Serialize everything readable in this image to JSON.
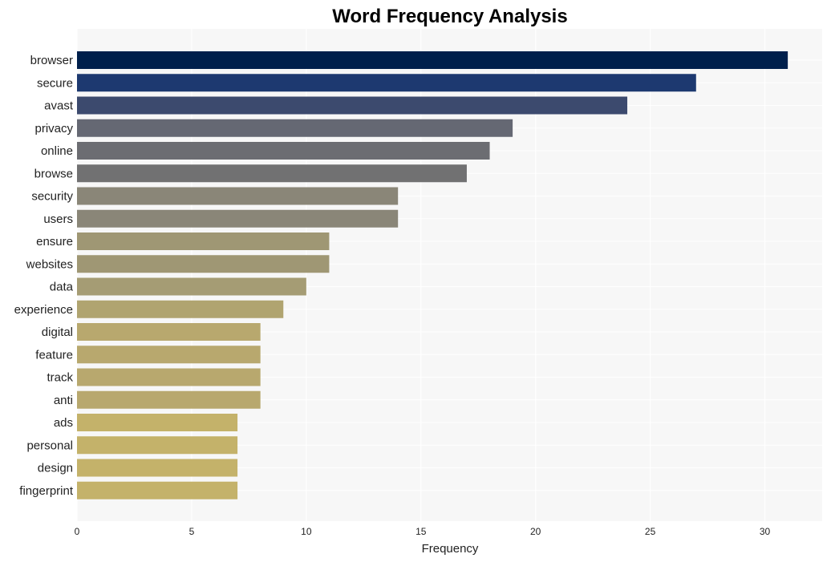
{
  "chart_data": {
    "type": "bar",
    "orientation": "horizontal",
    "title": "Word Frequency Analysis",
    "xlabel": "Frequency",
    "ylabel": "",
    "xlim": [
      0,
      32.5
    ],
    "xticks": [
      0,
      5,
      10,
      15,
      20,
      25,
      30
    ],
    "grid": true,
    "categories": [
      "browser",
      "secure",
      "avast",
      "privacy",
      "online",
      "browse",
      "security",
      "users",
      "ensure",
      "websites",
      "data",
      "experience",
      "digital",
      "feature",
      "track",
      "anti",
      "ads",
      "personal",
      "design",
      "fingerprint"
    ],
    "values": [
      31,
      27,
      24,
      19,
      18,
      17,
      14,
      14,
      11,
      11,
      10,
      9,
      8,
      8,
      8,
      8,
      7,
      7,
      7,
      7
    ],
    "colors": [
      "#00204c",
      "#1d3970",
      "#3c4a6e",
      "#656873",
      "#6c6d72",
      "#717172",
      "#8a8678",
      "#8a8678",
      "#9f9774",
      "#9f9774",
      "#a59c74",
      "#b0a470",
      "#b8a86e",
      "#b8a86e",
      "#b8a86e",
      "#b8a86e",
      "#c4b26a",
      "#c4b26a",
      "#c4b26a",
      "#c4b26a"
    ],
    "plot_background": "#f7f7f7"
  }
}
